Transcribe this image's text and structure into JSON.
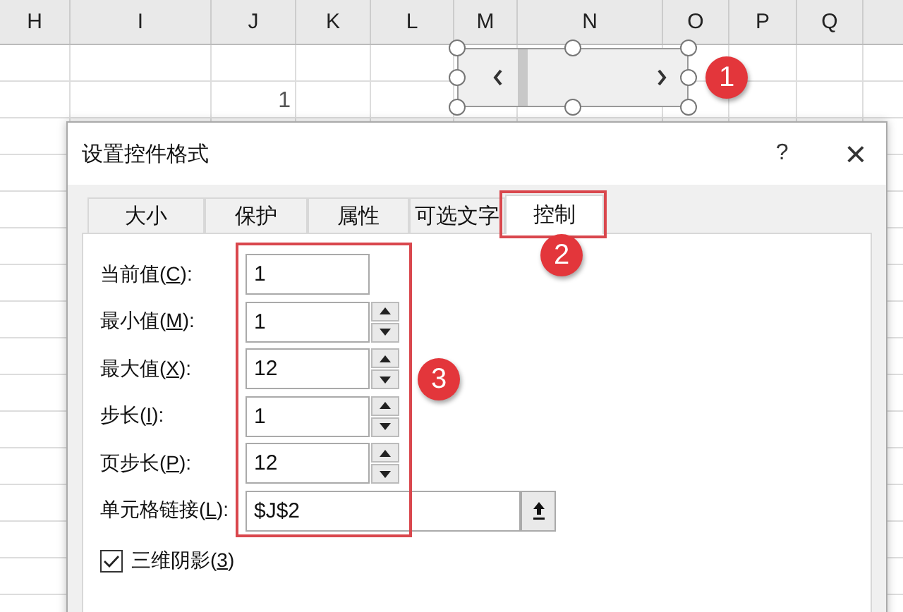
{
  "sheet": {
    "columns": [
      "H",
      "I",
      "J",
      "K",
      "L",
      "M",
      "N",
      "O",
      "P",
      "Q"
    ],
    "rows": [
      [
        null,
        null,
        null,
        null,
        null,
        null,
        null,
        null,
        null,
        null
      ],
      [
        null,
        null,
        "1",
        null,
        null,
        null,
        null,
        null,
        null,
        null
      ]
    ]
  },
  "scroll_control": {
    "badge": "1"
  },
  "dialog": {
    "title": "设置控件格式",
    "help": "?",
    "close": "×",
    "tabs": [
      {
        "label": "大小",
        "selected": false
      },
      {
        "label": "保护",
        "selected": false
      },
      {
        "label": "属性",
        "selected": false
      },
      {
        "label": "可选文字",
        "selected": false
      },
      {
        "label": "控制",
        "selected": true
      }
    ],
    "tab_badge": "2",
    "fields": [
      {
        "kind": "text",
        "label_before": "当前值(",
        "key": "C",
        "label_after": "):",
        "value": "1"
      },
      {
        "kind": "spin",
        "label_before": "最小值(",
        "key": "M",
        "label_after": "):",
        "value": "1"
      },
      {
        "kind": "spin",
        "label_before": "最大值(",
        "key": "X",
        "label_after": "):",
        "value": "12"
      },
      {
        "kind": "spin",
        "label_before": "步长(",
        "key": "I",
        "label_after": "):",
        "value": "1"
      },
      {
        "kind": "spin",
        "label_before": "页步长(",
        "key": "P",
        "label_after": "):",
        "value": "12"
      },
      {
        "kind": "ref",
        "label_before": "单元格链接(",
        "key": "L",
        "label_after": "):",
        "value": "$J$2"
      }
    ],
    "fields_badge": "3",
    "checkbox": {
      "label_before": "三维阴影(",
      "key": "3",
      "label_after": ")",
      "checked": true
    }
  }
}
